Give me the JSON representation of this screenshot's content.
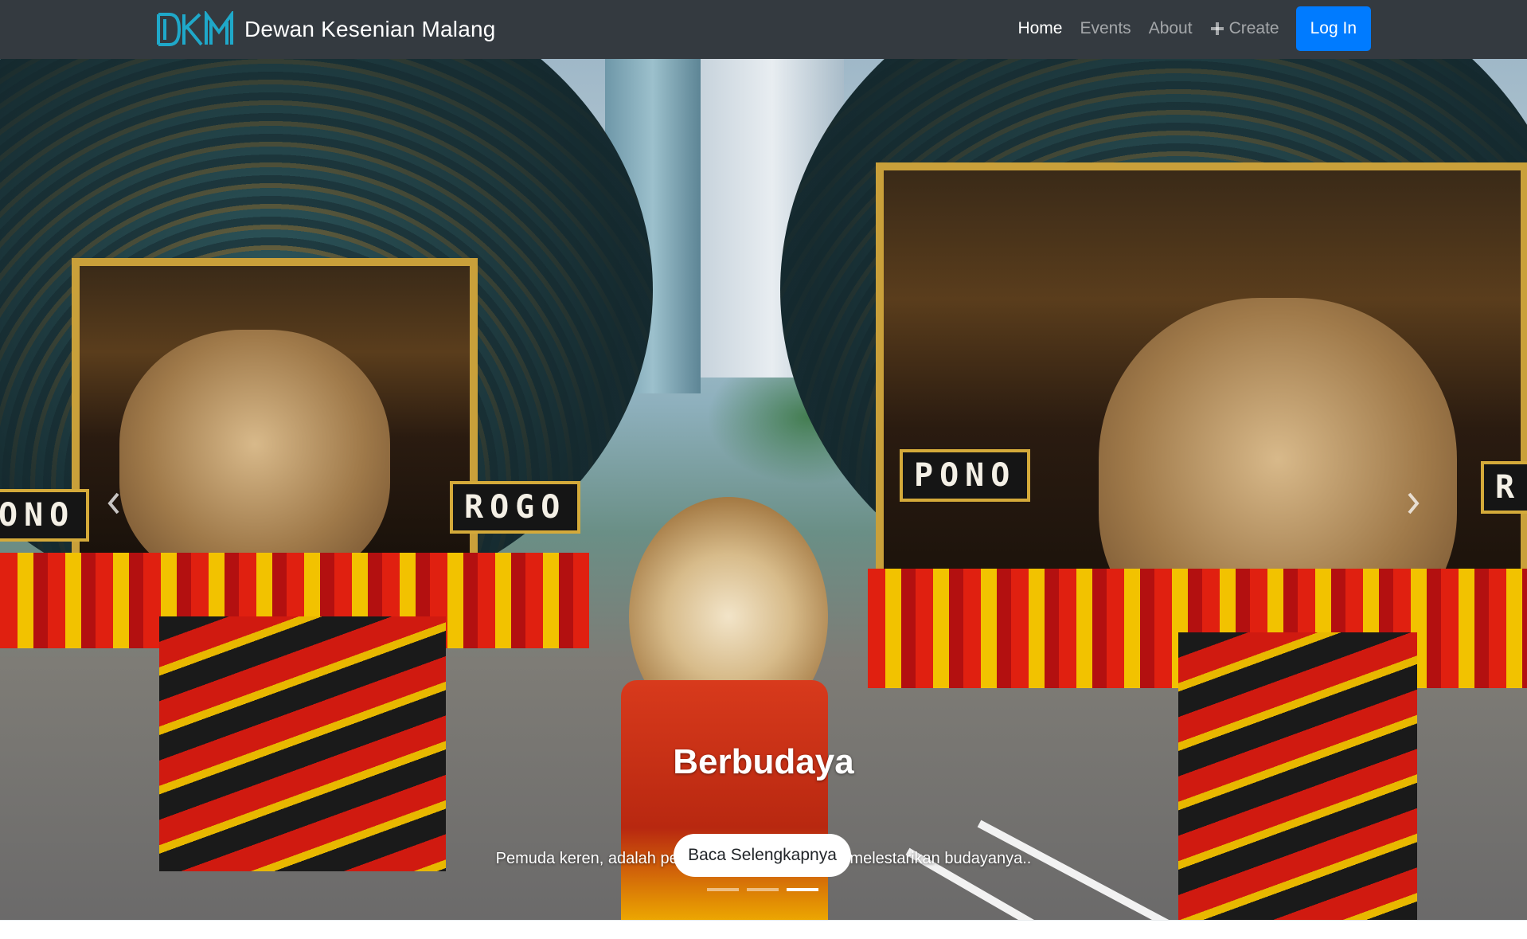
{
  "navbar": {
    "brand_text": "Dewan Kesenian Malang",
    "brand_logo_text": "DKM",
    "links": [
      {
        "label": "Home",
        "active": true
      },
      {
        "label": "Events",
        "active": false
      },
      {
        "label": "About",
        "active": false
      },
      {
        "label": "Create",
        "icon": "plus-icon",
        "active": false
      }
    ],
    "login_label": "Log In"
  },
  "carousel": {
    "image_subject": "reog-ponorogo-parade",
    "banner_left": "ONO",
    "banner_left2": "ROGO",
    "banner_right": "PONO",
    "banner_right2": "R",
    "caption_title": "Berbudaya",
    "caption_text": "Pemuda keren, adalah pemuda yang bangga dan melestarikan budayanya..",
    "button_label": "Baca Selengkapnya",
    "slide_count": 3,
    "active_slide": 3,
    "prev_icon": "chevron-left-icon",
    "next_icon": "chevron-right-icon"
  },
  "colors": {
    "navbar_bg": "#343a40",
    "primary": "#007bff",
    "logo_accent": "#1fa8c9"
  }
}
